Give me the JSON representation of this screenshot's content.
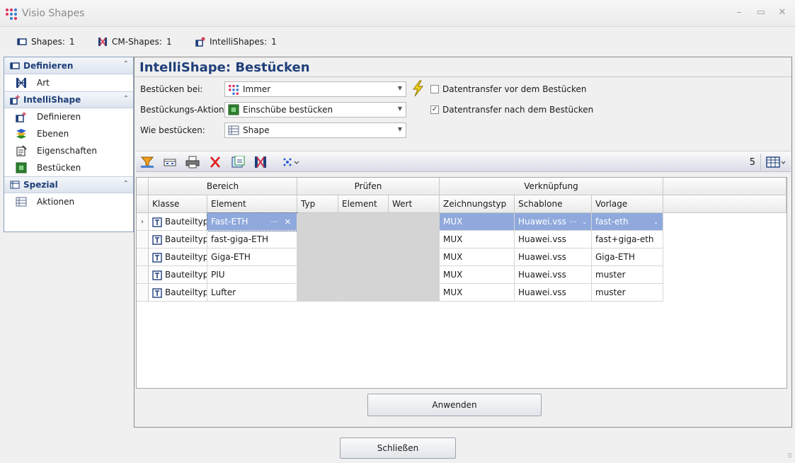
{
  "window": {
    "title": "Visio Shapes",
    "minimize": "–",
    "maximize": "▭",
    "close": "✕"
  },
  "counts": [
    {
      "label": "Shapes:",
      "value": "1"
    },
    {
      "label": "CM-Shapes:",
      "value": "1"
    },
    {
      "label": "IntelliShapes:",
      "value": "1"
    }
  ],
  "sidebar": {
    "sections": [
      {
        "title": "Definieren",
        "items": [
          "Art"
        ]
      },
      {
        "title": "IntelliShape",
        "items": [
          "Definieren",
          "Ebenen",
          "Eigenschaften",
          "Bestücken"
        ]
      },
      {
        "title": "Spezial",
        "items": [
          "Aktionen"
        ]
      }
    ],
    "collapse_glyph": "⌃"
  },
  "main": {
    "title": "IntelliShape:  Bestücken",
    "form": {
      "bestuecken_bei": {
        "label": "Bestücken bei:",
        "value": "Immer"
      },
      "aktion": {
        "label": "Bestückungs-Aktion:",
        "value": "Einschübe bestücken"
      },
      "wie": {
        "label": "Wie bestücken:",
        "value": "Shape"
      },
      "transfer_vor": {
        "label": "Datentransfer vor dem Bestücken",
        "checked": false
      },
      "transfer_nach": {
        "label": "Datentransfer nach dem Bestücken",
        "checked": true
      }
    },
    "toolbar": {
      "count": "5"
    },
    "grid": {
      "bands": [
        "Bereich",
        "Prüfen",
        "Verknüpfung"
      ],
      "columns": [
        "Klasse",
        "Element",
        "Typ",
        "Element",
        "Wert",
        "Zeichnungstyp",
        "Schablone",
        "Vorlage"
      ],
      "rows": [
        {
          "klasse": "Bauteiltyp",
          "element": "Fast-ETH",
          "typ": "",
          "p_element": "",
          "wert": "",
          "zeichnungstyp": "MUX",
          "schablone": "Huawei.vss",
          "vorlage": "fast-eth"
        },
        {
          "klasse": "Bauteiltyp",
          "element": "fast-giga-ETH",
          "typ": "",
          "p_element": "",
          "wert": "",
          "zeichnungstyp": "MUX",
          "schablone": "Huawei.vss",
          "vorlage": "fast+giga-eth"
        },
        {
          "klasse": "Bauteiltyp",
          "element": "Giga-ETH",
          "typ": "",
          "p_element": "",
          "wert": "",
          "zeichnungstyp": "MUX",
          "schablone": "Huawei.vss",
          "vorlage": "Giga-ETH"
        },
        {
          "klasse": "Bauteiltyp",
          "element": "PIU",
          "typ": "",
          "p_element": "",
          "wert": "",
          "zeichnungstyp": "MUX",
          "schablone": "Huawei.vss",
          "vorlage": "muster"
        },
        {
          "klasse": "Bauteiltyp",
          "element": "Lufter",
          "typ": "",
          "p_element": "",
          "wert": "",
          "zeichnungstyp": "MUX",
          "schablone": "Huawei.vss",
          "vorlage": "muster"
        }
      ],
      "current_row_marker": "›",
      "edit_dots": "···",
      "edit_clear": "✕",
      "dropdown_glyph": "⌄"
    },
    "apply_label": "Anwenden"
  },
  "close_label": "Schließen",
  "grip": "⠿"
}
